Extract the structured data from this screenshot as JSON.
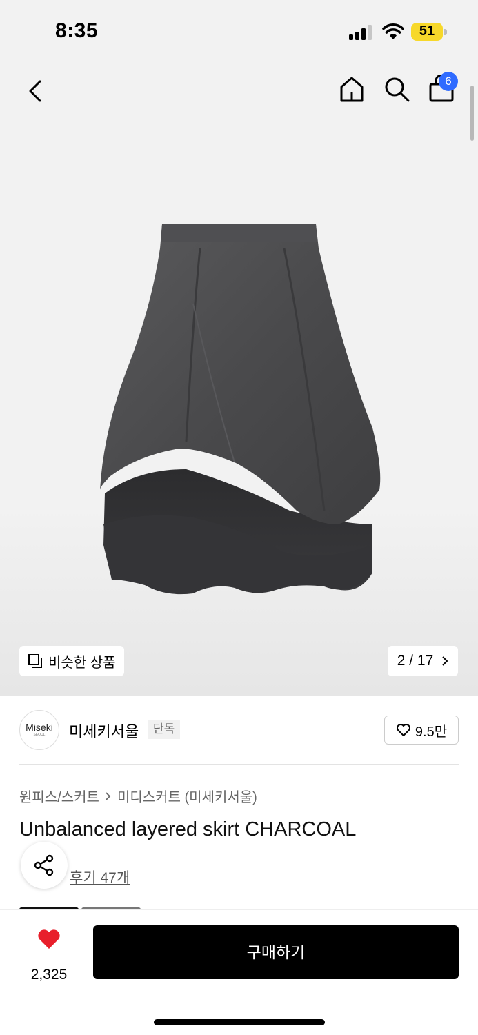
{
  "status_bar": {
    "time": "8:35",
    "battery": "51"
  },
  "header": {
    "cart_count": "6"
  },
  "gallery": {
    "similar_label": "비슷한 상품",
    "page_current": "2",
    "page_separator": "/",
    "page_total": "17"
  },
  "brand": {
    "logo_text": "Miseki",
    "logo_sub": "SEOUL",
    "name": "미세키서울",
    "tag": "단독",
    "like_count": "9.5만"
  },
  "breadcrumb": {
    "category": "원피스/스커트",
    "subcategory": "미디스커트 (미세키서울)"
  },
  "product": {
    "title": "Unbalanced layered skirt CHARCOAL",
    "reviews": "후기 47개"
  },
  "bottom_bar": {
    "like_count": "2,325",
    "buy_label": "구매하기"
  },
  "colors": {
    "accent_badge": "#2f6bff",
    "heart": "#e81f2b",
    "battery": "#f7d82a"
  }
}
